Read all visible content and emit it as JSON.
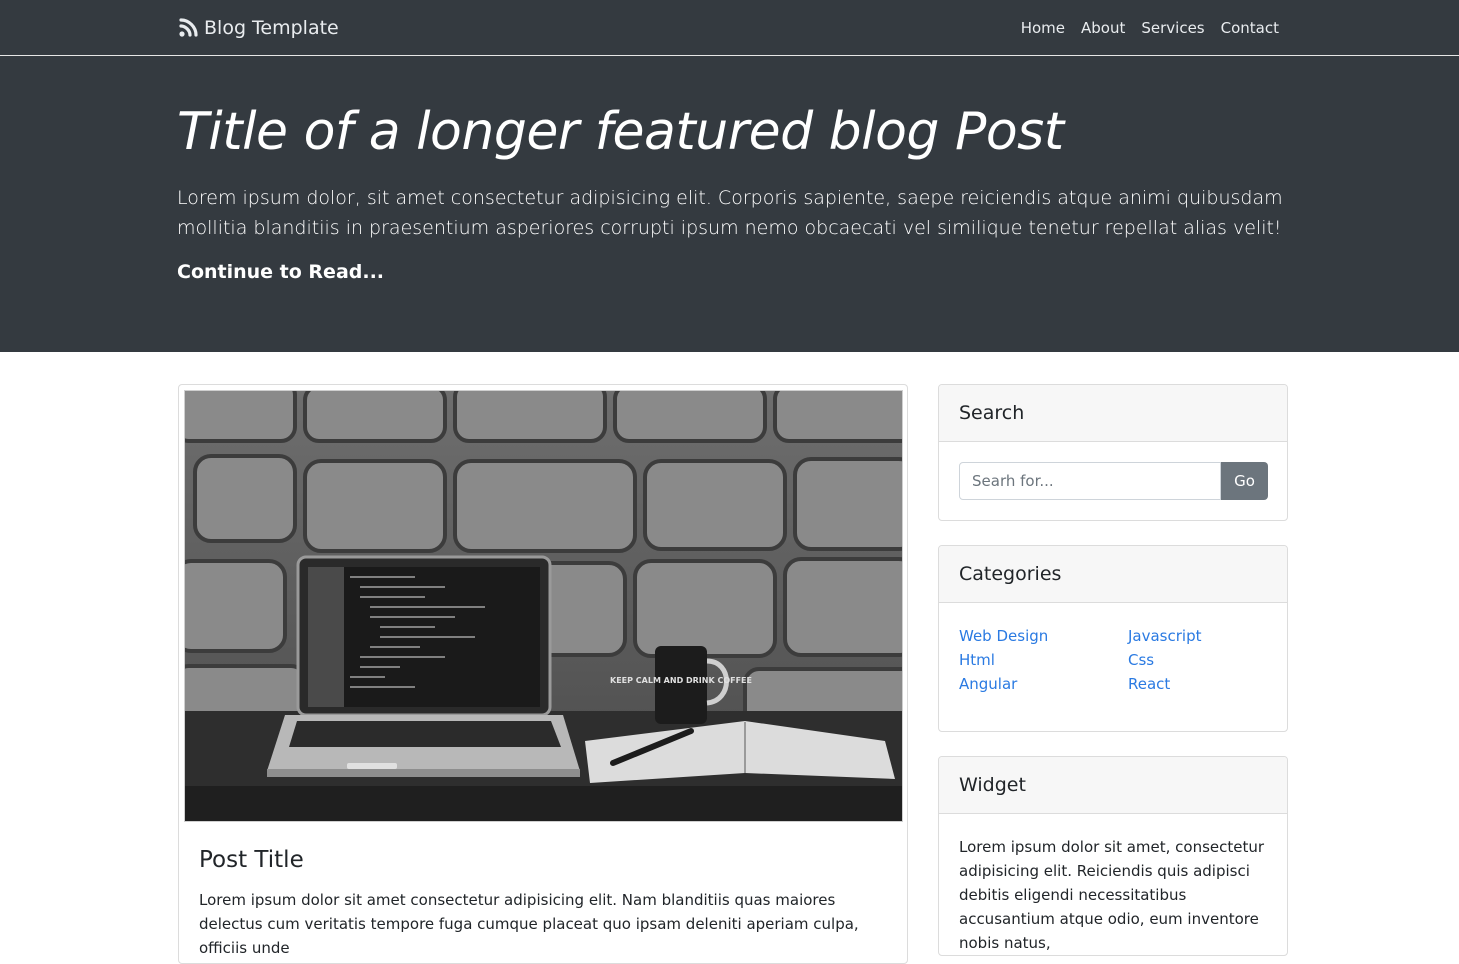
{
  "nav": {
    "brand": "Blog Template",
    "links": [
      "Home",
      "About",
      "Services",
      "Contact"
    ]
  },
  "hero": {
    "title": "Title of a longer featured blog Post",
    "lead": "Lorem ipsum dolor, sit amet consectetur adipisicing elit. Corporis sapiente, saepe reiciendis atque animi quibusdam mollitia blanditiis in praesentium asperiores corrupti ipsum nemo obcaecati vel similique tenetur repellat alias velit!",
    "link": "Continue to Read..."
  },
  "post": {
    "title": "Post Title",
    "text": "Lorem ipsum dolor sit amet consectetur adipisicing elit. Nam blanditiis quas maiores delectus cum veritatis tempore fuga cumque placeat quo ipsam deleniti aperiam culpa, officiis unde",
    "mug_text": "KEEP CALM AND DRINK COFFEE"
  },
  "search": {
    "heading": "Search",
    "placeholder": "Searh for...",
    "button": "Go"
  },
  "categories": {
    "heading": "Categories",
    "items": [
      "Web Design",
      "Javascript",
      "Html",
      "Css",
      "Angular",
      "React"
    ]
  },
  "widget": {
    "heading": "Widget",
    "text": "Lorem ipsum dolor sit amet, consectetur adipisicing elit. Reiciendis quis adipisci debitis eligendi necessitatibus accusantium atque odio, eum inventore nobis natus,"
  },
  "colors": {
    "dark": "#343a40",
    "link": "#2a7ae2",
    "button": "#6c757d"
  }
}
